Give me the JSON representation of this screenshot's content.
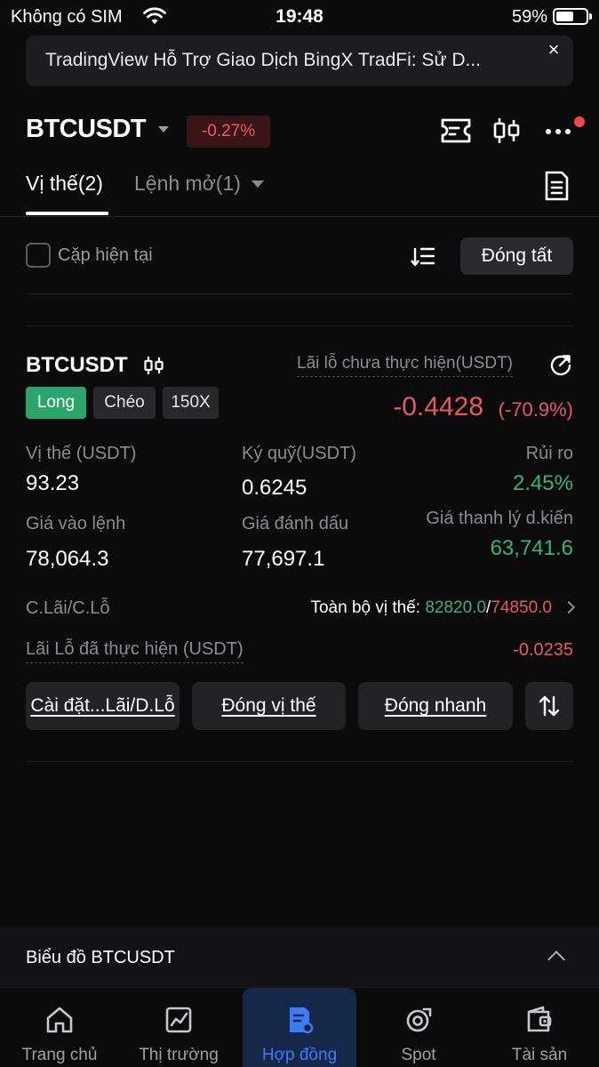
{
  "status_bar": {
    "carrier": "Không có SIM",
    "time": "19:48",
    "battery": "59%",
    "battery_level": 0.59
  },
  "banner": {
    "text": "TradingView Hỗ Trợ Giao Dịch BingX TradFi: Sử D...",
    "close": "×"
  },
  "header": {
    "symbol": "BTCUSDT",
    "change": "-0.27%",
    "icons": [
      "ticket-icon",
      "candlestick-icon",
      "more-icon"
    ]
  },
  "tabs": {
    "positions": "Vị thế(2)",
    "open_orders": "Lệnh mở(1)"
  },
  "filter": {
    "current_pair": "Cặp hiện tại",
    "close_all": "Đóng tất"
  },
  "position": {
    "symbol": "BTCUSDT",
    "pnl_label": "Lãi lỗ chưa thực hiện(USDT)",
    "side": "Long",
    "margin_mode": "Chéo",
    "leverage": "150X",
    "pnl_value": "-0.4428",
    "pnl_pct": "(-70.9%)",
    "size_label": "Vị thế (USDT)",
    "size_value": "93.23",
    "margin_label": "Ký quỹ(USDT)",
    "margin_value": "0.6245",
    "risk_label": "Rủi ro",
    "risk_value": "2.45%",
    "entry_label": "Giá vào lệnh",
    "entry_value": "78,064.3",
    "mark_label": "Giá đánh dấu",
    "mark_value": "77,697.1",
    "liq_label": "Giá thanh lý d.kiến",
    "liq_value": "63,741.6",
    "tpsl_label": "C.Lãi/C.Lỗ",
    "tpsl_prefix": "Toàn bộ vị thế: ",
    "tp_value": "82820.0",
    "sl_value": "74850.0",
    "realized_label": "Lãi Lỗ đã thực hiện (USDT)",
    "realized_value": "-0.0235"
  },
  "actions": {
    "tpsl": "Cài đặt...Lãi/D.Lỗ",
    "close": "Đóng vị thế",
    "quick_close": "Đóng nhanh"
  },
  "chart_bar": {
    "title": "Biểu đồ BTCUSDT"
  },
  "bottom_nav": [
    {
      "label": "Trang chủ",
      "icon": "home-icon"
    },
    {
      "label": "Thị trường",
      "icon": "market-icon"
    },
    {
      "label": "Hợp đồng",
      "icon": "contract-icon"
    },
    {
      "label": "Spot",
      "icon": "spot-icon"
    },
    {
      "label": "Tài sản",
      "icon": "wallet-icon"
    }
  ],
  "colors": {
    "background": "#0b0b0c",
    "green": "#3bb27a",
    "red": "#e85a5f",
    "accent": "#3d7cf5"
  }
}
